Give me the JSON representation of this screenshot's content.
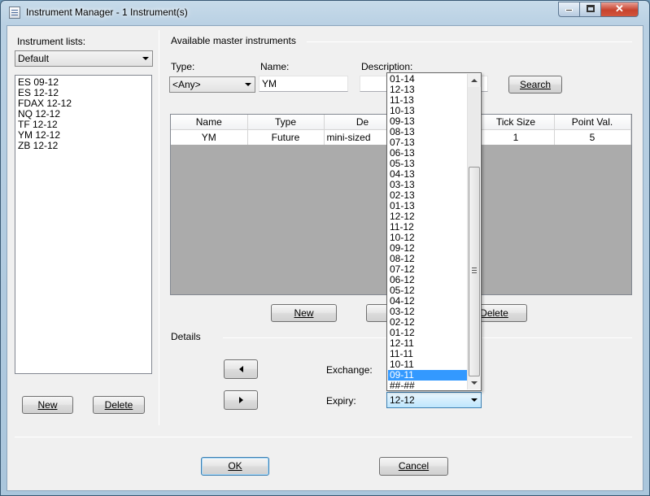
{
  "window": {
    "title": "Instrument Manager - 1 Instrument(s)",
    "controls": {
      "minimize": "–",
      "maximize": "□",
      "close": "✕"
    }
  },
  "left_panel": {
    "lists_label": "Instrument lists:",
    "selected_list": "Default",
    "instruments": [
      "ES 09-12",
      "ES 12-12",
      "FDAX 12-12",
      "NQ 12-12",
      "TF 12-12",
      "YM 12-12",
      "ZB 12-12"
    ],
    "new_label": "New",
    "delete_label": "Delete"
  },
  "master": {
    "section_label": "Available master instruments",
    "type_label": "Type:",
    "type_value": "<Any>",
    "name_label": "Name:",
    "name_value": "YM",
    "description_label": "Description:",
    "description_value": "",
    "search_label": "Search",
    "columns": [
      "Name",
      "Type",
      "De",
      "Tick Size",
      "Point Val."
    ],
    "rows": [
      {
        "name": "YM",
        "type": "Future",
        "desc": "mini-sized",
        "tick_size": "1",
        "point_value": "5"
      }
    ],
    "new_label": "New",
    "delete_label": "Delete"
  },
  "details": {
    "section_label": "Details",
    "exchange_label": "Exchange:",
    "expiry_label": "Expiry:",
    "expiry_value": "12-12",
    "expiry_options": [
      "01-14",
      "12-13",
      "11-13",
      "10-13",
      "09-13",
      "08-13",
      "07-13",
      "06-13",
      "05-13",
      "04-13",
      "03-13",
      "02-13",
      "01-13",
      "12-12",
      "11-12",
      "10-12",
      "09-12",
      "08-12",
      "07-12",
      "06-12",
      "05-12",
      "04-12",
      "03-12",
      "02-12",
      "01-12",
      "12-11",
      "11-11",
      "10-11",
      "09-11",
      "##-##"
    ],
    "highlighted_option": "09-11"
  },
  "footer": {
    "ok_label": "OK",
    "cancel_label": "Cancel"
  },
  "colors": {
    "selection": "#3399ff",
    "grid_background": "#ababab",
    "close_button": "#c7432e"
  }
}
